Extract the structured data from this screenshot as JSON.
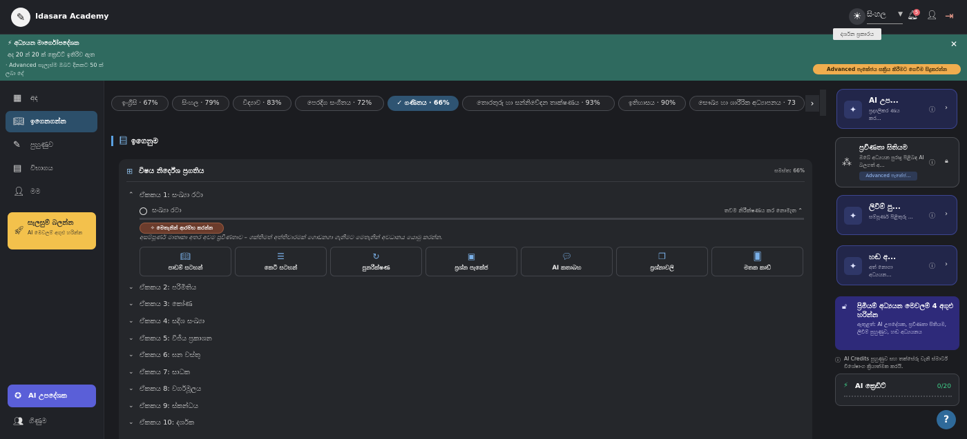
{
  "header": {
    "brand": "Idasara Academy",
    "language": "සිංහල",
    "notification_count": "5",
    "theme_tooltip": "දර්ශන ප්‍රකාරය"
  },
  "banner": {
    "title": "අධ්‍යයන මාර්ගෝපදේශක",
    "credits_line": "අද 20 න් 20 ක් ක්‍රෙඩිට් ඉතිරිව ඇත",
    "advanced_line": "· Advanced සැලැස්ම ඔබට දිනකට 50 ක් ලබා දේ",
    "advanced_button": "Advanced පැකේජය සක්‍රිය කිරීමට ගෙවීම සිදුකරන්න"
  },
  "sidebar": {
    "items": [
      {
        "label": "අද",
        "icon": "calendar-icon"
      },
      {
        "label": "ඉගෙනගන්න",
        "icon": "book-icon",
        "active": true
      },
      {
        "label": "පුහුණුව",
        "icon": "pencil-icon"
      },
      {
        "label": "විභාගය",
        "icon": "exam-icon"
      },
      {
        "label": "මම",
        "icon": "person-icon"
      }
    ],
    "premium": {
      "title": "සැලසුම් බලන්න",
      "subtitle": "AI මෙවලම් අගුළු හරින්න"
    },
    "ai_advisor": "AI උපදේශක",
    "accounts": "ගිණුම"
  },
  "subject_tabs": [
    "ඉංග්‍රීසි · 67%",
    "සිංහල · 79%",
    "විද්‍යාව · 83%",
    "පෙරදිග සංගීතය · 72%",
    "ගණිතය · 66%",
    "තොරතුරු හා සන්නිවේදන තාක්ෂණය · 93%",
    "ඉතිහාසය · 90%",
    "සෞඛ්‍ය හා ශාරීරික අධ්‍යාපනය · 73"
  ],
  "section_title": "ඉගෙනුම",
  "panel": {
    "title": "විෂය නිර්දේශ ප්‍රගතිය",
    "total": "සමස්ත: 66%",
    "first_unit": "ඒකකය 1: සංඛ්‍යා රටා",
    "topic": "සංඛ්‍යා රටා",
    "topic_action": "තවම නිරීක්ෂණය කර නොමැත",
    "start_button": "මෙතැනින් ආරම්භ කරන්න",
    "hint": "අසම්පූර්ණ මාතෘකා අතර අවම ප්‍රවීණතාව – ශක්තිමත් අත්තිවාරමක් ගොඩනගා ගැනීමට මෙතැනින් අවධානය යොමු කරන්න.",
    "resources": [
      {
        "label": "පාඩම් සටහන්",
        "icon": "open-book-icon"
      },
      {
        "label": "කෙටි සටහන්",
        "icon": "short-notes-icon"
      },
      {
        "label": "පුනරීක්ෂණ",
        "icon": "revision-icon"
      },
      {
        "label": "ප්‍රශ්න පැකේජ",
        "icon": "archive-icon"
      },
      {
        "label": "AI කතාබහ",
        "icon": "chat-icon"
      },
      {
        "label": "ප්‍රශ්නාවලි",
        "icon": "quiz-icon"
      },
      {
        "label": "මතක කාඩ්",
        "icon": "flashcards-icon"
      }
    ],
    "units": [
      "ඒකකය 2: පරිමිතිය",
      "ඒකකය 3: කෝණ",
      "ඒකකය 4: සදිශ සංඛ්‍යා",
      "ඒකකය 5: වීජීය ප්‍රකාශන",
      "ඒකකය 6: ඝන වස්තු",
      "ඒකකය 7: සාධක",
      "ඒකකය 8: වර්ගමූලය",
      "ඒකකය 9: ස්කන්ධය",
      "ඒකකය 10: දර්ශක"
    ]
  },
  "right_panel": {
    "cards": [
      {
        "title": "AI උප...",
        "subtitle": "ප්‍රද්‍යලිකර ණය කර..."
      },
      {
        "title": "ලිවීම් පු...",
        "subtitle": "සම්පූර්ණ පිළිතුරු ..."
      },
      {
        "title": "හඬ අ...",
        "subtitle": "අත් නොගා අධ්‍යයන..."
      }
    ],
    "proficiency": {
      "title": "ප්‍රවීණතා සිතියම",
      "subtitle": "ඔබේ අධ්‍යයන පුරාදු පිළිබඳ AI බලගත් අ...",
      "tag": "Advanced පැකේජ..."
    },
    "unlock": {
      "title": "ප්‍රිමියම් අධ්‍යයන මෙවලම් 4 අගුළු හරින්න",
      "subtitle": "ඇතුළත්: AI උපදේශක, ප්‍රවීණතා සිතියම, ලිවීම් පුහුණුව, හඬ අධ්‍යයනය"
    },
    "note": "AI Credits පුහුණුව සහ තක්සේරු වැනි ස්මාර්ට් විශේෂාංග ක්‍රියාත්මක කරයි.",
    "credits_label": "AI ක්‍රෙඩිට්",
    "credits_value": "0/20"
  }
}
